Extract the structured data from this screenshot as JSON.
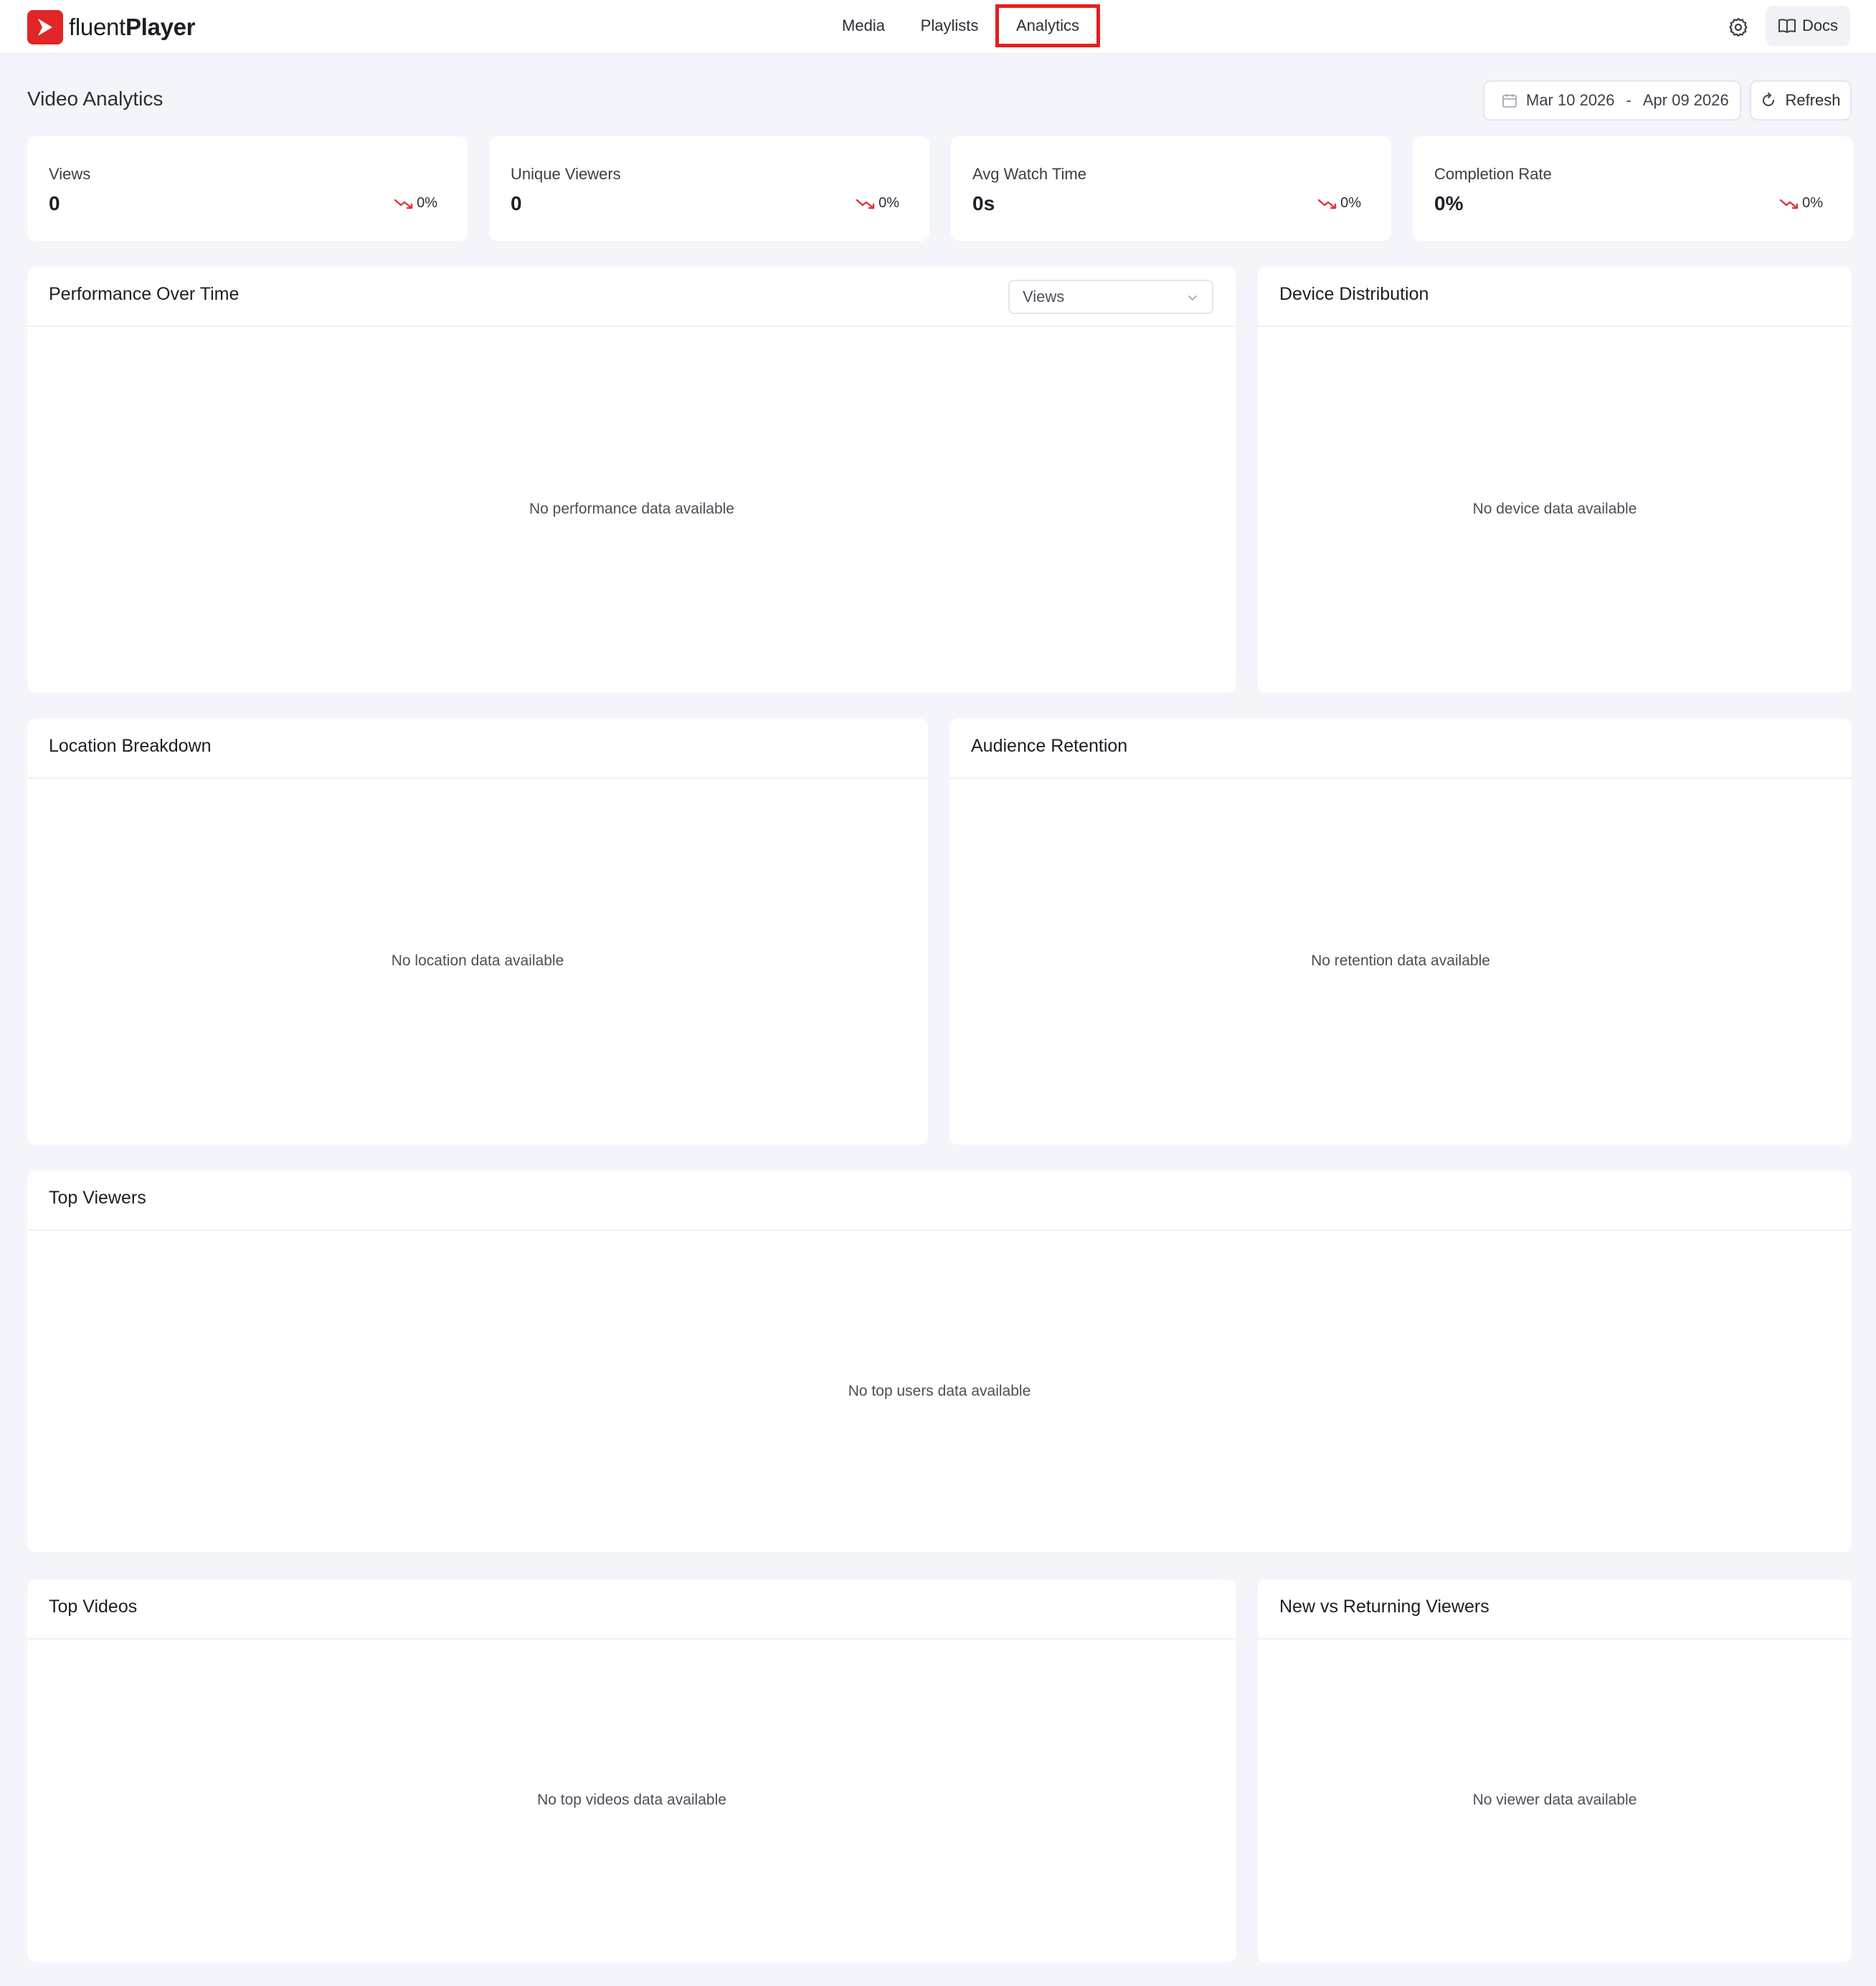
{
  "brand": {
    "name_light": "fluent",
    "name_bold": "Player"
  },
  "nav": {
    "media": "Media",
    "playlists": "Playlists",
    "analytics": "Analytics"
  },
  "header_actions": {
    "docs": "Docs"
  },
  "page": {
    "title": "Video Analytics"
  },
  "date_range": {
    "start": "Mar 10 2026",
    "separator": "-",
    "end": "Apr 09 2026"
  },
  "refresh_label": "Refresh",
  "stats": [
    {
      "label": "Views",
      "value": "0",
      "change": "0%"
    },
    {
      "label": "Unique Viewers",
      "value": "0",
      "change": "0%"
    },
    {
      "label": "Avg Watch Time",
      "value": "0s",
      "change": "0%"
    },
    {
      "label": "Completion Rate",
      "value": "0%",
      "change": "0%"
    }
  ],
  "panels": {
    "performance": {
      "title": "Performance Over Time",
      "metric_select": "Views",
      "empty": "No performance data available"
    },
    "device": {
      "title": "Device Distribution",
      "empty": "No device data available"
    },
    "location": {
      "title": "Location Breakdown",
      "empty": "No location data available"
    },
    "retention": {
      "title": "Audience Retention",
      "empty": "No retention data available"
    },
    "top_viewers": {
      "title": "Top Viewers",
      "empty": "No top users data available"
    },
    "top_videos": {
      "title": "Top Videos",
      "empty": "No top videos data available"
    },
    "new_vs_returning": {
      "title": "New vs Returning Viewers",
      "empty": "No viewer data available"
    }
  },
  "colors": {
    "brand": "#e02626",
    "trend_down": "#e0323a",
    "active_highlight": "#e4201d"
  }
}
